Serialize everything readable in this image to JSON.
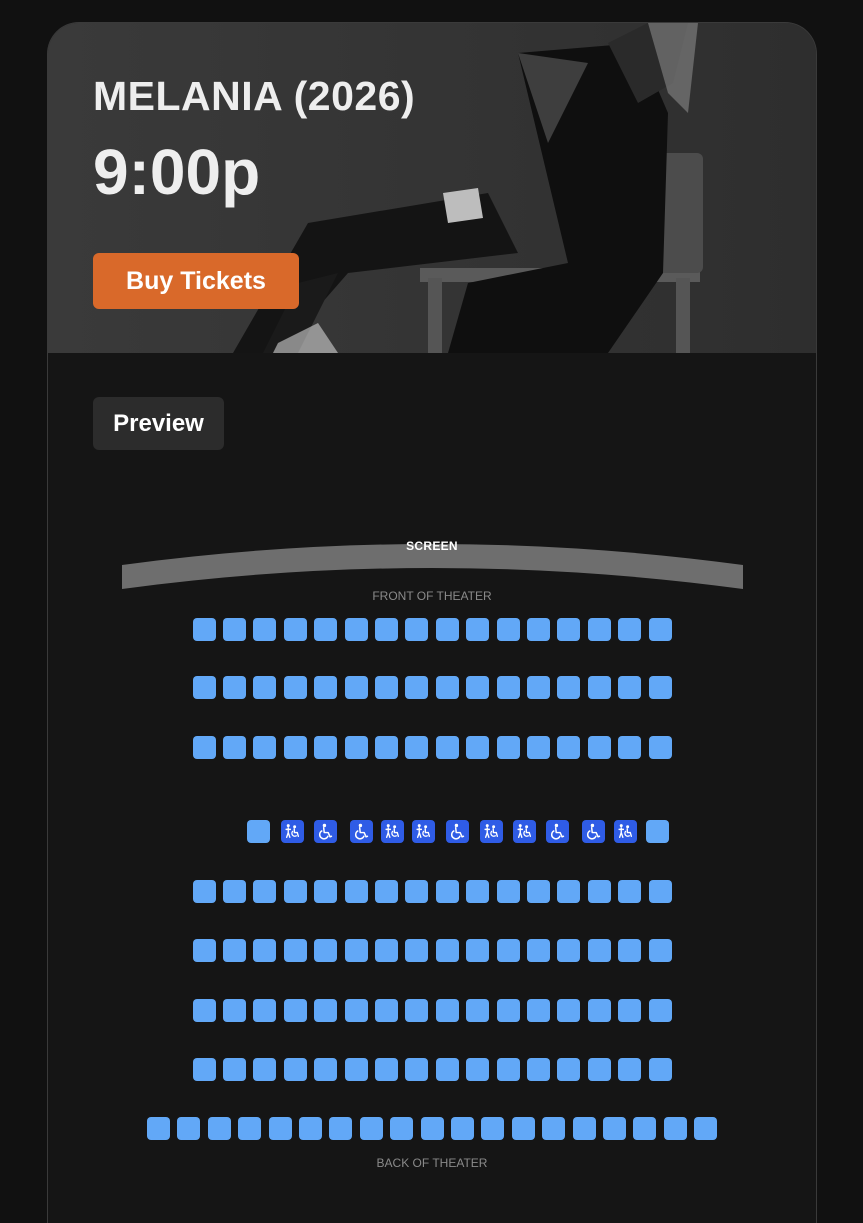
{
  "movie": {
    "title": "MELANIA (2026)",
    "showtime": "9:00p"
  },
  "actions": {
    "buy_label": "Buy Tickets",
    "preview_label": "Preview"
  },
  "seat_map": {
    "screen_label": "SCREEN",
    "front_label": "FRONT OF THEATER",
    "back_label": "BACK OF THEATER",
    "colors": {
      "available": "#62a8f7",
      "accessible": "#2f5ce6",
      "buy_button": "#d9692a"
    },
    "rows": [
      {
        "seats": 16,
        "types": "standard"
      },
      {
        "seats": 16,
        "types": "standard"
      },
      {
        "seats": 16,
        "types": "standard"
      },
      {
        "seats": 13,
        "types": [
          "standard",
          "companion",
          "wheelchair",
          "wheelchair",
          "companion",
          "companion",
          "wheelchair",
          "companion",
          "companion",
          "wheelchair",
          "wheelchair",
          "companion",
          "standard"
        ]
      },
      {
        "seats": 16,
        "types": "standard"
      },
      {
        "seats": 16,
        "types": "standard"
      },
      {
        "seats": 16,
        "types": "standard"
      },
      {
        "seats": 16,
        "types": "standard"
      },
      {
        "seats": 19,
        "types": "standard"
      }
    ]
  }
}
